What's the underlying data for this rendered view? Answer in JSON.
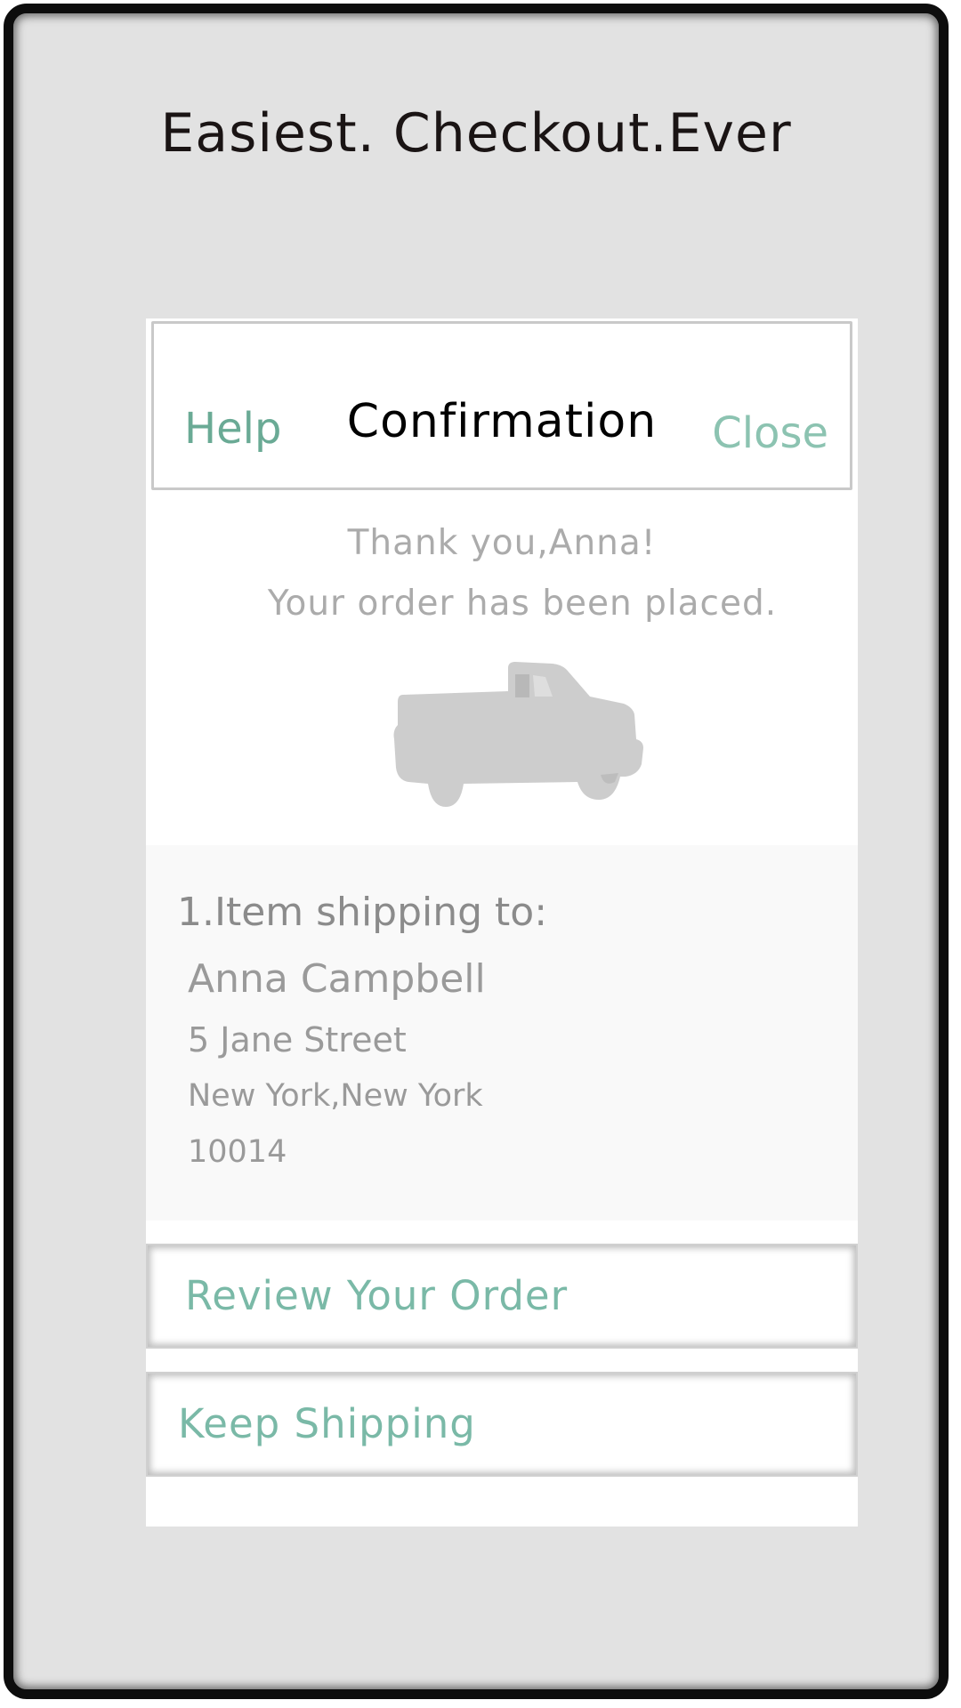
{
  "page": {
    "headline": "Easiest. Checkout.Ever"
  },
  "dialog": {
    "title": "Confirmation",
    "help_label": "Help",
    "close_label": "Close",
    "thanks_line_1": "Thank you,Anna!",
    "thanks_line_2": "Your order has been placed.",
    "illustration_icon": "pickup-truck-icon"
  },
  "shipping": {
    "heading": "1.Item shipping to:",
    "name": "Anna Campbell",
    "street": "5 Jane Street",
    "city_state": "New York,New York",
    "zip": "10014"
  },
  "actions": {
    "review_label": "Review Your Order",
    "keep_label": "Keep Shipping"
  },
  "colors": {
    "accent": "#6aaa95",
    "accent_light": "#8cc3b1",
    "muted_text": "#9a9a9a",
    "frame_bg": "#e2e2e2"
  }
}
